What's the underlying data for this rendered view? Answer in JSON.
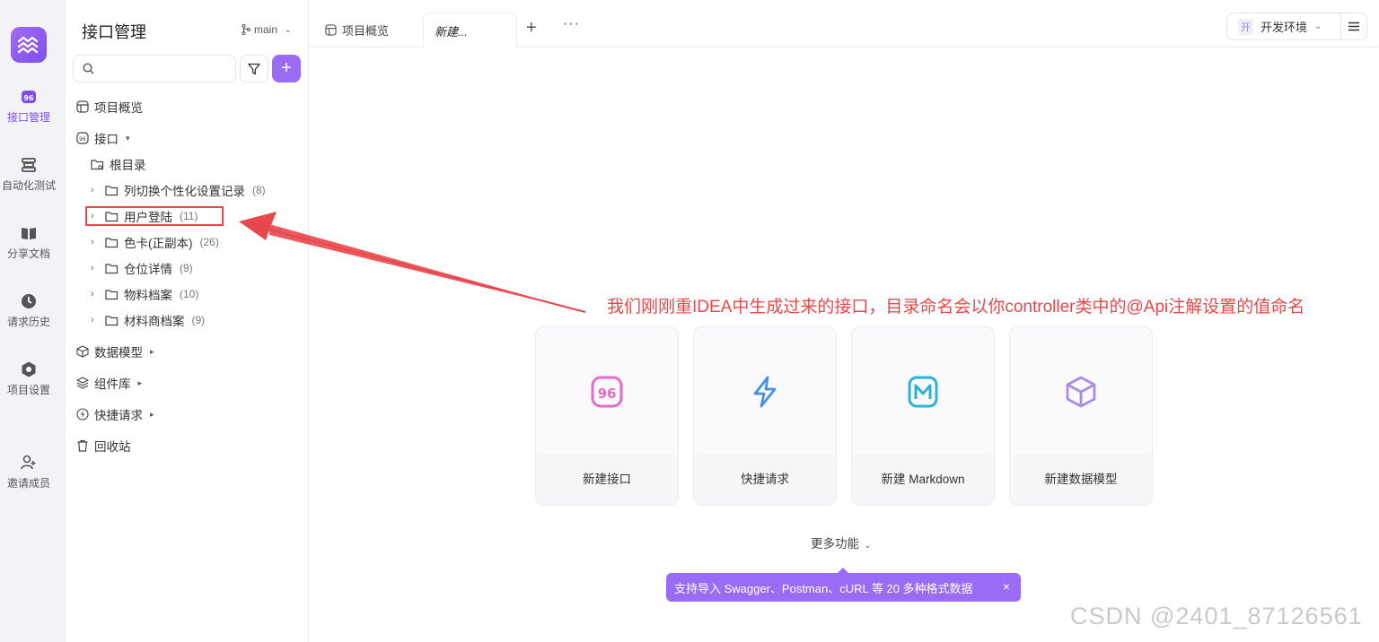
{
  "app": {
    "title": "接口管理",
    "branch": "main"
  },
  "rail": {
    "items": [
      {
        "label": "接口管理",
        "icon": "api-icon"
      },
      {
        "label": "自动化测试",
        "icon": "automation-icon"
      },
      {
        "label": "分享文档",
        "icon": "book-icon"
      },
      {
        "label": "请求历史",
        "icon": "clock-icon"
      },
      {
        "label": "项目设置",
        "icon": "settings-icon"
      },
      {
        "label": "邀请成员",
        "icon": "add-user-icon"
      }
    ]
  },
  "sidebar": {
    "search_placeholder": "",
    "overview": "项目概览",
    "api_section": "接口",
    "root": "根目录",
    "folders": [
      {
        "name": "列切换个性化设置记录",
        "count": "(8)"
      },
      {
        "name": "用户登陆",
        "count": "(11)"
      },
      {
        "name": "色卡(正副本)",
        "count": "(26)"
      },
      {
        "name": "仓位详情",
        "count": "(9)"
      },
      {
        "name": "物料档案",
        "count": "(10)"
      },
      {
        "name": "材料商档案",
        "count": "(9)"
      }
    ],
    "data_models": "数据模型",
    "components": "组件库",
    "quick_requests": "快捷请求",
    "recycle_bin": "回收站"
  },
  "tabs": [
    {
      "label": "项目概览"
    },
    {
      "label": "新建..."
    }
  ],
  "env": {
    "badge": "开",
    "label": "开发环境"
  },
  "annotation": "我们刚刚重IDEA中生成过来的接口，目录命名会以你controller类中的@Api注解设置的值命名",
  "cards": [
    {
      "label": "新建接口",
      "icon": "api-icon",
      "color": "#e86bc4"
    },
    {
      "label": "快捷请求",
      "icon": "lightning-icon",
      "color": "#4a90e2"
    },
    {
      "label": "新建 Markdown",
      "icon": "markdown-icon",
      "color": "#2bb3d6"
    },
    {
      "label": "新建数据模型",
      "icon": "cube-icon",
      "color": "#a98be8"
    }
  ],
  "more_features": "更多功能",
  "tip": {
    "text": "支持导入 Swagger、Postman、cURL 等 20 多种格式数据",
    "close": "×"
  },
  "watermark": "CSDN @2401_87126561",
  "colors": {
    "accent": "#9a6bf5",
    "annotation": "#e8474b"
  }
}
